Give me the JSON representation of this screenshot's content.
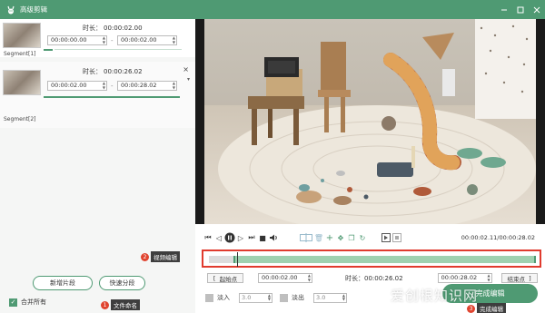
{
  "window": {
    "title": "高级剪辑"
  },
  "segments": [
    {
      "name": "Segment[1]",
      "duration_label": "时长：",
      "duration": "00:00:02.00",
      "start": "00:00:00.00",
      "end": "00:00:02.00",
      "separator": "-"
    },
    {
      "name": "Segment[2]",
      "duration_label": "时长：",
      "duration": "00:00:26.02",
      "start": "00:00:02.00",
      "end": "00:00:28.02",
      "separator": "-"
    }
  ],
  "buttons": {
    "new_segment": "新增片段",
    "quick_split": "快速分段",
    "finish": "完成编辑"
  },
  "merge": {
    "label": "合并所有"
  },
  "annotations": [
    {
      "number": "1",
      "text": "文件命名"
    },
    {
      "number": "2",
      "text": "视频编辑"
    },
    {
      "number": "3",
      "text": "完成编辑"
    }
  ],
  "player": {
    "time": "00:00:02.11/00:00:28.02"
  },
  "edit": {
    "start_label": "起始点",
    "start_time": "00:00:02.00",
    "duration_label": "时长：",
    "duration": "00:00:26.02",
    "end_time": "00:00:28.02",
    "end_label": "结束点"
  },
  "fade": {
    "in_label": "淡入",
    "in_value": "3.0",
    "out_label": "淡出",
    "out_value": "3.0"
  },
  "watermark": "爱创根知识网",
  "colors": {
    "accent": "#4f9a73",
    "highlight": "#e03b2e",
    "badge": "#e0442f"
  }
}
